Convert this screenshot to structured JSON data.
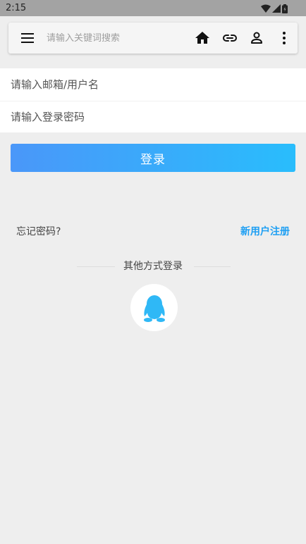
{
  "status_bar": {
    "time": "2:15",
    "icons": [
      "wifi-icon",
      "cell-signal-icon",
      "battery-icon"
    ]
  },
  "toolbar": {
    "search_placeholder": "请输入关键词搜索",
    "icons": [
      "menu-icon",
      "home-icon",
      "link-icon",
      "person-icon",
      "more-vert-icon"
    ]
  },
  "form": {
    "username_placeholder": "请输入邮箱/用户名",
    "password_placeholder": "请输入登录密码"
  },
  "login_label": "登录",
  "forgot_label": "忘记密码?",
  "register_label": "新用户注册",
  "other_methods_label": "其他方式登录",
  "social": {
    "icon": "qq-penguin-icon",
    "color": "#2fb8f6"
  },
  "colors": {
    "accent": "#1e9ff3",
    "gradient_start": "#4a97f9",
    "gradient_end": "#29bdfc"
  }
}
